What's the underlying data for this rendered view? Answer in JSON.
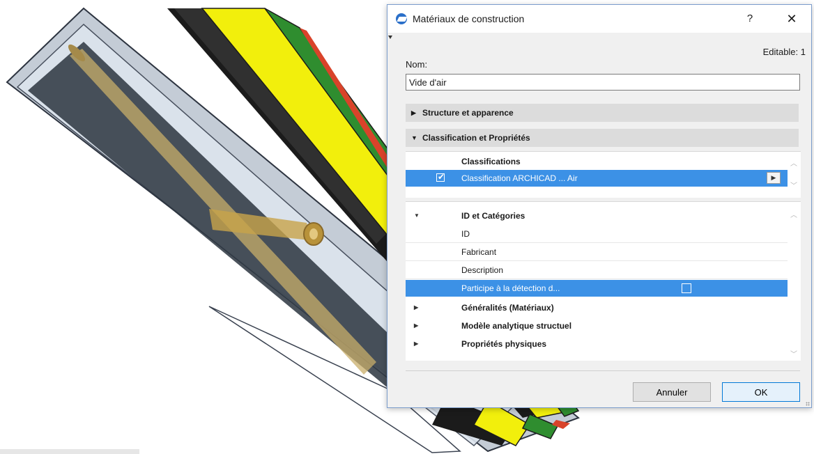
{
  "dialog": {
    "title": "Matériaux de construction",
    "help_label": "?",
    "close_label": "✕",
    "editable_text": "Editable: 1",
    "name_label": "Nom:",
    "name_value": "Vide d'air",
    "sections": [
      {
        "label": "Structure et apparence",
        "expanded": false
      },
      {
        "label": "Classification et Propriétés",
        "expanded": true
      }
    ],
    "classifications": {
      "header": "Classifications",
      "item": "Classification ARCHICAD ... Air",
      "checked": true
    },
    "properties": {
      "group_header": "ID et Catégories",
      "rows": [
        "ID",
        "Fabricant",
        "Description",
        "Participe à la détection d..."
      ],
      "collapsed_groups": [
        "Généralités (Matériaux)",
        "Modèle analytique structuel",
        "Propriétés physiques"
      ]
    },
    "buttons": {
      "cancel": "Annuler",
      "ok": "OK"
    }
  },
  "icons": {
    "app": "archicad-app-icon",
    "expand": "triangle-right-icon",
    "collapse": "triangle-down-icon",
    "more": "arrow-right-icon",
    "check": "check-icon"
  },
  "colors": {
    "selection": "#3c91e6",
    "accent": "#0078d7",
    "layers": [
      "#f0f3f6",
      "#1b1b1b",
      "#f2ef0c",
      "#2f8d2f",
      "#d9432a"
    ]
  }
}
